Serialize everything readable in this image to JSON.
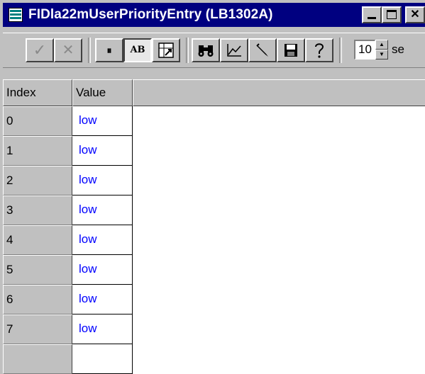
{
  "window": {
    "title": "FIDla22mUserPriorityEntry (LB1302A)",
    "icon": "table-icon"
  },
  "title_buttons": {
    "minimize": "minimize-icon",
    "maximize": "maximize-icon",
    "close": "✕"
  },
  "toolbar": {
    "apply": "✓",
    "cancel": "✕",
    "pause": "⏸",
    "ab_label": "AB",
    "refresh_value": "10",
    "seconds_label": "se"
  },
  "grid": {
    "columns": [
      "Index",
      "Value"
    ],
    "rows": [
      {
        "index": "0",
        "value": "low"
      },
      {
        "index": "1",
        "value": "low"
      },
      {
        "index": "2",
        "value": "low"
      },
      {
        "index": "3",
        "value": "low"
      },
      {
        "index": "4",
        "value": "low"
      },
      {
        "index": "5",
        "value": "low"
      },
      {
        "index": "6",
        "value": "low"
      },
      {
        "index": "7",
        "value": "low"
      }
    ]
  },
  "colors": {
    "titlebar": "#000080",
    "chrome": "#c0c0c0",
    "value_text": "#0000ff"
  }
}
